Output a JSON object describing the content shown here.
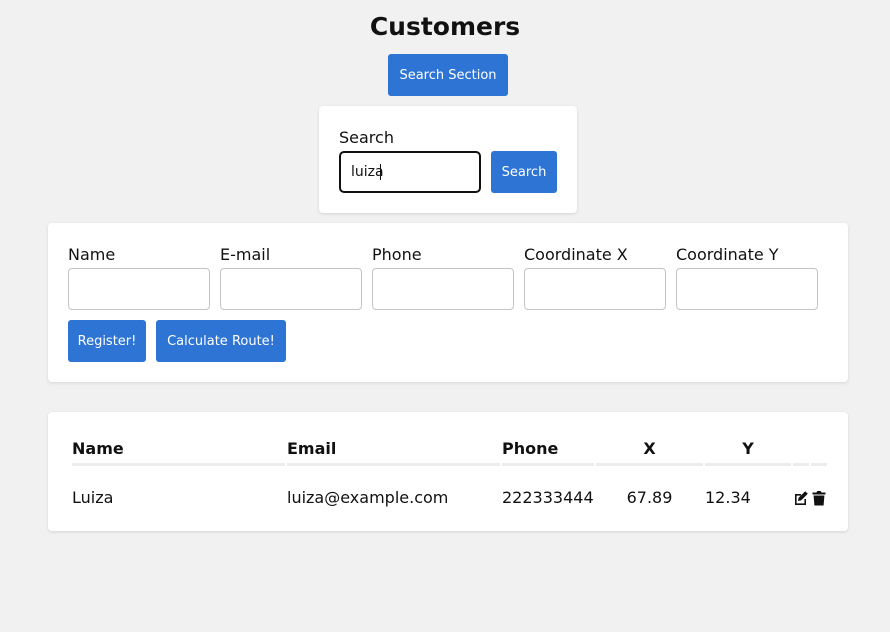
{
  "page": {
    "title": "Customers"
  },
  "search_section_button": {
    "label": "Search Section"
  },
  "search": {
    "label": "Search",
    "value": "luiza",
    "button_label": "Search"
  },
  "form": {
    "fields": [
      {
        "label": "Name",
        "value": ""
      },
      {
        "label": "E-mail",
        "value": ""
      },
      {
        "label": "Phone",
        "value": ""
      },
      {
        "label": "Coordinate X",
        "value": ""
      },
      {
        "label": "Coordinate Y",
        "value": ""
      }
    ],
    "register_label": "Register!",
    "route_label": "Calculate Route!"
  },
  "table": {
    "columns": [
      "Name",
      "Email",
      "Phone",
      "X",
      "Y",
      "",
      ""
    ],
    "rows": [
      {
        "name": "Luiza",
        "email": "luiza@example.com",
        "phone": "222333444",
        "x": "67.89",
        "y": "12.34"
      }
    ],
    "actions": [
      "edit-icon",
      "trash-icon"
    ]
  },
  "colors": {
    "accent": "#2e74d5",
    "background": "#f1f1f1"
  }
}
